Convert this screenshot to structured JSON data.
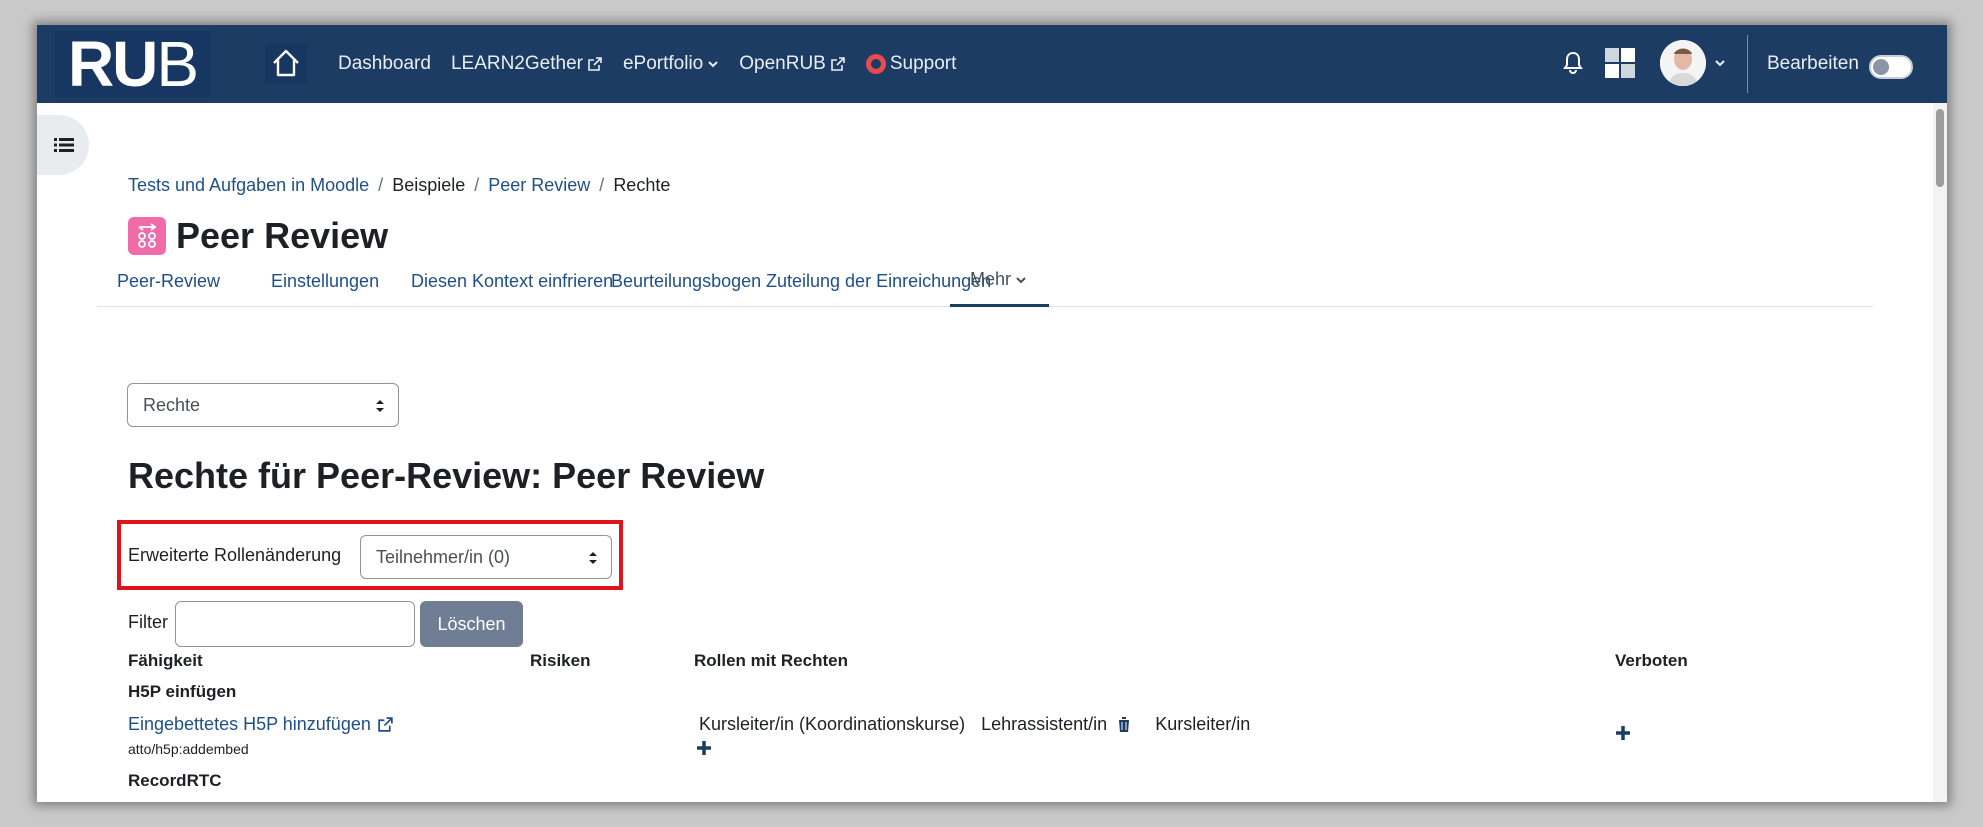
{
  "navbar": {
    "logo_ru": "RU",
    "logo_b": "B",
    "links": [
      "Dashboard",
      "LEARN2Gether",
      "ePortfolio",
      "OpenRUB",
      "Support"
    ],
    "edit_label": "Bearbeiten",
    "edit_mode": false
  },
  "breadcrumb": [
    "Tests und Aufgaben in Moodle",
    "Beispiele",
    "Peer Review",
    "Rechte"
  ],
  "page_title": "Peer Review",
  "secondary_nav": [
    "Peer-Review",
    "Einstellungen",
    "Diesen Kontext einfrieren",
    "Beurteilungsbogen",
    "Zuteilung der Einreichungen",
    "Mehr"
  ],
  "active_tab": "Mehr",
  "selector": {
    "selected": "Rechte"
  },
  "heading": "Rechte für Peer-Review: Peer Review",
  "advanced_role": {
    "label": "Erweiterte Rollenänderung",
    "selected": "Teilnehmer/in (0)"
  },
  "filter": {
    "label": "Filter",
    "value": "",
    "clear_label": "Löschen"
  },
  "table": {
    "headers": [
      "Fähigkeit",
      "Risiken",
      "Rollen mit Rechten",
      "Verboten"
    ],
    "groups": [
      {
        "title": "H5P einfügen",
        "capabilities": [
          {
            "name": "Eingebettetes H5P hinzufügen",
            "id": "atto/h5p:addembed",
            "roles": [
              "Kursleiter/in (Koordinationskurse)",
              "Lehrassistent/in",
              "Kursleiter/in"
            ]
          }
        ]
      },
      {
        "title": "RecordRTC",
        "capabilities": []
      }
    ]
  },
  "colors": {
    "navbar": "#1c3c64",
    "link": "#1f4f8a",
    "highlight": "#e0121b",
    "button": "#6f7e94",
    "module_icon": "#f06ba7"
  }
}
